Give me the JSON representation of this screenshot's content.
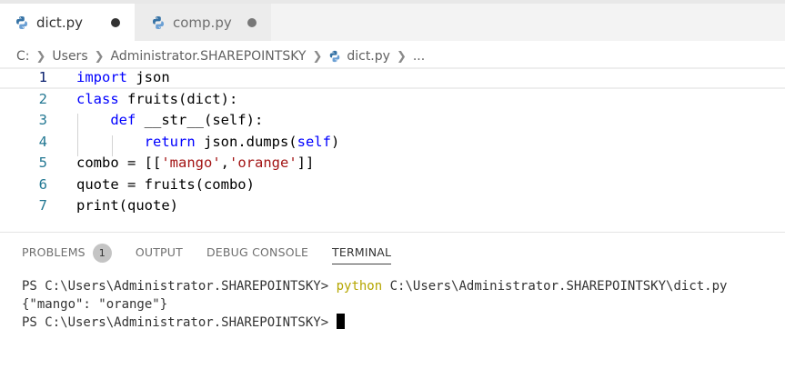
{
  "tabs": [
    {
      "label": "dict.py",
      "icon": "python-icon",
      "dirty": true
    },
    {
      "label": "comp.py",
      "icon": "python-icon",
      "dirty": true
    }
  ],
  "breadcrumb": {
    "items": [
      "C:",
      "Users",
      "Administrator.SHAREPOINTSKY",
      "dict.py",
      "..."
    ]
  },
  "editor": {
    "line_numbers": [
      "1",
      "2",
      "3",
      "4",
      "5",
      "6",
      "7"
    ],
    "lines": [
      {
        "tokens": [
          [
            "kw",
            "import"
          ],
          [
            "plain",
            " json"
          ]
        ]
      },
      {
        "tokens": [
          [
            "kw",
            "class"
          ],
          [
            "plain",
            " fruits(dict):"
          ]
        ]
      },
      {
        "tokens": [
          [
            "plain",
            "    "
          ],
          [
            "kw",
            "def"
          ],
          [
            "plain",
            " __str__(self):"
          ]
        ]
      },
      {
        "tokens": [
          [
            "plain",
            "        "
          ],
          [
            "kw",
            "return"
          ],
          [
            "plain",
            " json.dumps("
          ],
          [
            "kw2",
            "self"
          ],
          [
            "plain",
            ")"
          ]
        ]
      },
      {
        "tokens": [
          [
            "plain",
            "combo = [["
          ],
          [
            "str",
            "'mango'"
          ],
          [
            "plain",
            ","
          ],
          [
            "str",
            "'orange'"
          ],
          [
            "plain",
            "]]"
          ]
        ]
      },
      {
        "tokens": [
          [
            "plain",
            "quote = fruits(combo)"
          ]
        ]
      },
      {
        "tokens": [
          [
            "plain",
            "print(quote)"
          ]
        ]
      }
    ]
  },
  "panel": {
    "tabs": [
      "PROBLEMS",
      "OUTPUT",
      "DEBUG CONSOLE",
      "TERMINAL"
    ],
    "problems_count": "1",
    "active_tab": "TERMINAL"
  },
  "terminal": {
    "prompt": "PS C:\\Users\\Administrator.SHAREPOINTSKY>",
    "command_name": "python",
    "command_args": " C:\\Users\\Administrator.SHAREPOINTSKY\\dict.py",
    "output": "{\"mango\": \"orange\"}",
    "prompt2": "PS C:\\Users\\Administrator.SHAREPOINTSKY>"
  },
  "colors": {
    "keyword": "#0000ff",
    "string": "#a31515",
    "line_number": "#237893",
    "command": "#b5a600"
  }
}
